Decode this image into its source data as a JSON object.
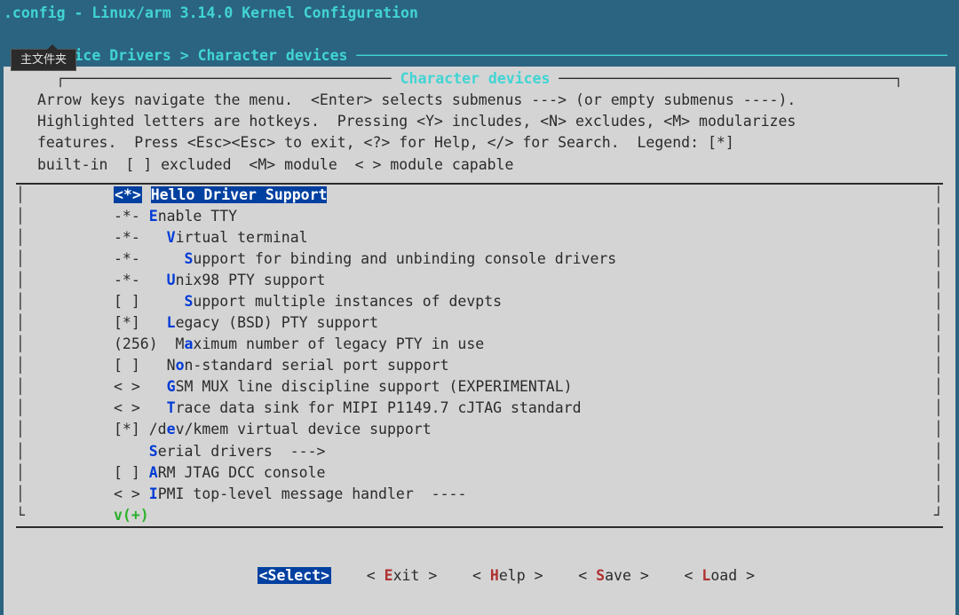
{
  "header": {
    "title": ".config - Linux/arm 3.14.0 Kernel Configuration",
    "breadcrumb_prefix": " > ",
    "breadcrumb": "Device Drivers > Character devices"
  },
  "tooltip": "主文件夹",
  "panel": {
    "title": "Character devices",
    "help": "Arrow keys navigate the menu.  <Enter> selects submenus ---> (or empty submenus ----).\nHighlighted letters are hotkeys.  Pressing <Y> includes, <N> excludes, <M> modularizes\nfeatures.  Press <Esc><Esc> to exit, <?> for Help, </> for Search.  Legend: [*]\nbuilt-in  [ ] excluded  <M> module  < > module capable"
  },
  "menu": [
    {
      "bracket": "<*>",
      "pre": "",
      "hot": "He",
      "rest": "llo Driver Support",
      "indent": 0,
      "selected": true
    },
    {
      "bracket": "-*-",
      "pre": "",
      "hot": "E",
      "rest": "nable TTY",
      "indent": 0
    },
    {
      "bracket": "-*-",
      "pre": "  ",
      "hot": "V",
      "rest": "irtual terminal",
      "indent": 0
    },
    {
      "bracket": "-*-",
      "pre": "    ",
      "hot": "S",
      "rest": "upport for binding and unbinding console drivers",
      "indent": 0
    },
    {
      "bracket": "-*-",
      "pre": "  ",
      "hot": "U",
      "rest": "nix98 PTY support",
      "indent": 0
    },
    {
      "bracket": "[ ]",
      "pre": "    ",
      "hot": "S",
      "rest": "upport multiple instances of devpts",
      "indent": 0
    },
    {
      "bracket": "[*]",
      "pre": "  ",
      "hot": "L",
      "rest": "egacy (BSD) PTY support",
      "indent": 0
    },
    {
      "bracket": "(256)",
      "pre": "  M",
      "hot": "a",
      "rest": "ximum number of legacy PTY in use",
      "indent": 0,
      "noSpaceAfterBracket": true
    },
    {
      "bracket": "[ ]",
      "pre": "  N",
      "hot": "o",
      "rest": "n-standard serial port support",
      "indent": 0
    },
    {
      "bracket": "< >",
      "pre": "  ",
      "hot": "G",
      "rest": "SM MUX line discipline support (EXPERIMENTAL)",
      "indent": 0
    },
    {
      "bracket": "< >",
      "pre": "  ",
      "hot": "T",
      "rest": "race data sink for MIPI P1149.7 cJTAG standard",
      "indent": 0
    },
    {
      "bracket": "[*]",
      "pre": "/d",
      "hot": "e",
      "rest": "v/kmem virtual device support",
      "indent": 0
    },
    {
      "bracket": "   ",
      "pre": "",
      "hot": "S",
      "rest": "erial drivers  --->",
      "indent": 0
    },
    {
      "bracket": "[ ]",
      "pre": "",
      "hot": "A",
      "rest": "RM JTAG DCC console",
      "indent": 0
    },
    {
      "bracket": "< >",
      "pre": "",
      "hot": "I",
      "rest": "PMI top-level message handler  ----",
      "indent": 0
    }
  ],
  "more_indicator": "v(+)",
  "buttons": {
    "select": {
      "open": "<",
      "hot": "S",
      "rest": "elect",
      "close": ">",
      "selected": true
    },
    "exit": {
      "open": "< ",
      "hot": "E",
      "rest": "xit ",
      "close": ">"
    },
    "help": {
      "open": "< ",
      "hot": "H",
      "rest": "elp ",
      "close": ">"
    },
    "save": {
      "open": "< ",
      "hot": "S",
      "rest": "ave ",
      "close": ">"
    },
    "load": {
      "open": "< ",
      "hot": "L",
      "rest": "oad ",
      "close": ">"
    }
  }
}
